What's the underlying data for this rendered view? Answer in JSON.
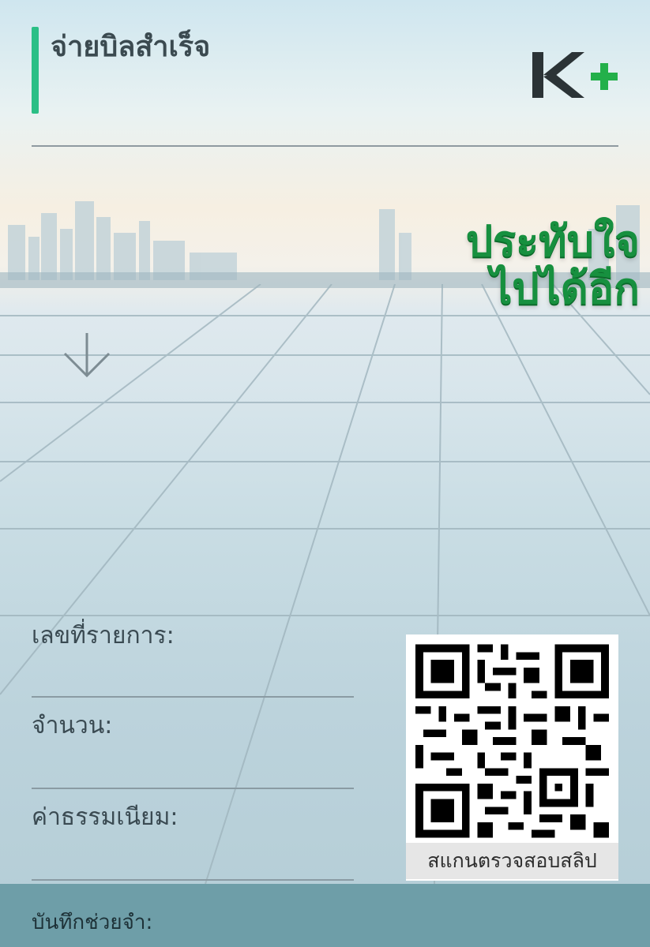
{
  "header": {
    "title": "จ่ายบิลสำเร็จ",
    "brand": "K+"
  },
  "banner": {
    "line1": "ประทับใจ",
    "line2": "ไปได้อีก"
  },
  "fields": {
    "reference_label": "เลขที่รายการ:",
    "amount_label": "จำนวน:",
    "fee_label": "ค่าธรรมเนียม:",
    "memo_label": "บันทึกช่วยจำ:"
  },
  "qr": {
    "caption": "สแกนตรวจสอบสลิป"
  },
  "colors": {
    "accent": "#2bbf86",
    "brand_dark": "#2b3336",
    "brand_green": "#23b04a",
    "headline_green": "#17903f",
    "memo_bar": "#6e9ea8"
  }
}
